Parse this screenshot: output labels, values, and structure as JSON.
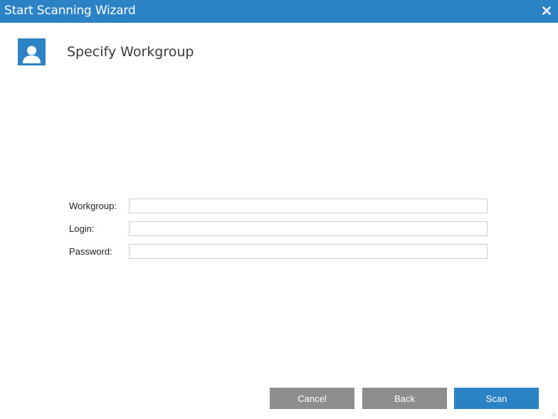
{
  "window": {
    "title": "Start Scanning Wizard",
    "close_icon": "close-icon"
  },
  "header": {
    "icon": "user-icon",
    "title": "Specify Workgroup"
  },
  "form": {
    "workgroup": {
      "label": "Workgroup:",
      "value": ""
    },
    "login": {
      "label": "Login:",
      "value": ""
    },
    "password": {
      "label": "Password:",
      "value": ""
    }
  },
  "buttons": {
    "cancel": "Cancel",
    "back": "Back",
    "scan": "Scan"
  },
  "colors": {
    "accent": "#2b82c4",
    "secondary_button": "#8e8e8e"
  }
}
